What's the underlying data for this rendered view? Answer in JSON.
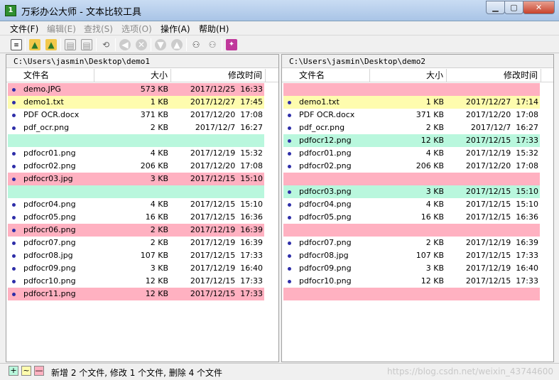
{
  "window": {
    "title": "万彩办公大师 - 文本比较工具",
    "app_icon_text": "1"
  },
  "menu": [
    {
      "label": "文件(F)",
      "enabled": true
    },
    {
      "label": "编辑(E)",
      "enabled": false
    },
    {
      "label": "查找(S)",
      "enabled": false
    },
    {
      "label": "选项(O)",
      "enabled": false
    },
    {
      "label": "操作(A)",
      "enabled": true
    },
    {
      "label": "帮助(H)",
      "enabled": true
    }
  ],
  "left": {
    "path": "C:\\Users\\jasmin\\Desktop\\demo1",
    "columns": {
      "name": "文件名",
      "size": "大小",
      "date": "修改时间"
    },
    "rows": [
      {
        "status": "pink",
        "name": "demo.JPG",
        "size": "573 KB",
        "date": "2017/12/25  16:33"
      },
      {
        "status": "yellow",
        "name": "demo1.txt",
        "size": "1 KB",
        "date": "2017/12/27  17:45"
      },
      {
        "status": "none",
        "name": "PDF OCR.docx",
        "size": "371 KB",
        "date": "2017/12/20  17:08"
      },
      {
        "status": "none",
        "name": "pdf_ocr.png",
        "size": "2 KB",
        "date": "2017/12/7  16:27"
      },
      {
        "status": "green-empty",
        "name": "",
        "size": "",
        "date": ""
      },
      {
        "status": "none",
        "name": "pdfocr01.png",
        "size": "4 KB",
        "date": "2017/12/19  15:32"
      },
      {
        "status": "none",
        "name": "pdfocr02.png",
        "size": "206 KB",
        "date": "2017/12/20  17:08"
      },
      {
        "status": "pink",
        "name": "pdfocr03.jpg",
        "size": "3 KB",
        "date": "2017/12/15  15:10"
      },
      {
        "status": "green-empty",
        "name": "",
        "size": "",
        "date": ""
      },
      {
        "status": "none",
        "name": "pdfocr04.png",
        "size": "4 KB",
        "date": "2017/12/15  15:10"
      },
      {
        "status": "none",
        "name": "pdfocr05.png",
        "size": "16 KB",
        "date": "2017/12/15  16:36"
      },
      {
        "status": "pink",
        "name": "pdfocr06.png",
        "size": "2 KB",
        "date": "2017/12/19  16:39"
      },
      {
        "status": "none",
        "name": "pdfocr07.png",
        "size": "2 KB",
        "date": "2017/12/19  16:39"
      },
      {
        "status": "none",
        "name": "pdfocr08.jpg",
        "size": "107 KB",
        "date": "2017/12/15  17:33"
      },
      {
        "status": "none",
        "name": "pdfocr09.png",
        "size": "3 KB",
        "date": "2017/12/19  16:40"
      },
      {
        "status": "none",
        "name": "pdfocr10.png",
        "size": "12 KB",
        "date": "2017/12/15  17:33"
      },
      {
        "status": "pink",
        "name": "pdfocr11.png",
        "size": "12 KB",
        "date": "2017/12/15  17:33"
      }
    ]
  },
  "right": {
    "path": "C:\\Users\\jasmin\\Desktop\\demo2",
    "columns": {
      "name": "文件名",
      "size": "大小",
      "date": "修改时间"
    },
    "rows": [
      {
        "status": "pink-empty",
        "name": "",
        "size": "",
        "date": ""
      },
      {
        "status": "yellow",
        "name": "demo1.txt",
        "size": "1 KB",
        "date": "2017/12/27  17:14"
      },
      {
        "status": "none",
        "name": "PDF OCR.docx",
        "size": "371 KB",
        "date": "2017/12/20  17:08"
      },
      {
        "status": "none",
        "name": "pdf_ocr.png",
        "size": "2 KB",
        "date": "2017/12/7  16:27"
      },
      {
        "status": "green",
        "name": "pdfocr12.png",
        "size": "12 KB",
        "date": "2017/12/15  17:33"
      },
      {
        "status": "none",
        "name": "pdfocr01.png",
        "size": "4 KB",
        "date": "2017/12/19  15:32"
      },
      {
        "status": "none",
        "name": "pdfocr02.png",
        "size": "206 KB",
        "date": "2017/12/20  17:08"
      },
      {
        "status": "pink-empty",
        "name": "",
        "size": "",
        "date": ""
      },
      {
        "status": "green",
        "name": "pdfocr03.png",
        "size": "3 KB",
        "date": "2017/12/15  15:10"
      },
      {
        "status": "none",
        "name": "pdfocr04.png",
        "size": "4 KB",
        "date": "2017/12/15  15:10"
      },
      {
        "status": "none",
        "name": "pdfocr05.png",
        "size": "16 KB",
        "date": "2017/12/15  16:36"
      },
      {
        "status": "pink-empty",
        "name": "",
        "size": "",
        "date": ""
      },
      {
        "status": "none",
        "name": "pdfocr07.png",
        "size": "2 KB",
        "date": "2017/12/19  16:39"
      },
      {
        "status": "none",
        "name": "pdfocr08.jpg",
        "size": "107 KB",
        "date": "2017/12/15  17:33"
      },
      {
        "status": "none",
        "name": "pdfocr09.png",
        "size": "3 KB",
        "date": "2017/12/19  16:40"
      },
      {
        "status": "none",
        "name": "pdfocr10.png",
        "size": "12 KB",
        "date": "2017/12/15  17:33"
      },
      {
        "status": "pink-empty",
        "name": "",
        "size": "",
        "date": ""
      }
    ]
  },
  "status": {
    "add_symbol": "+",
    "mod_symbol": "~",
    "del_symbol": "—",
    "text": "新增 2 个文件, 修改 1 个文件, 删除 4 个文件",
    "watermark": "https://blog.csdn.net/weixin_43744600"
  },
  "colors": {
    "pink": "#ffb1c1",
    "yellow": "#fefcae",
    "green": "#b9f7dd"
  }
}
